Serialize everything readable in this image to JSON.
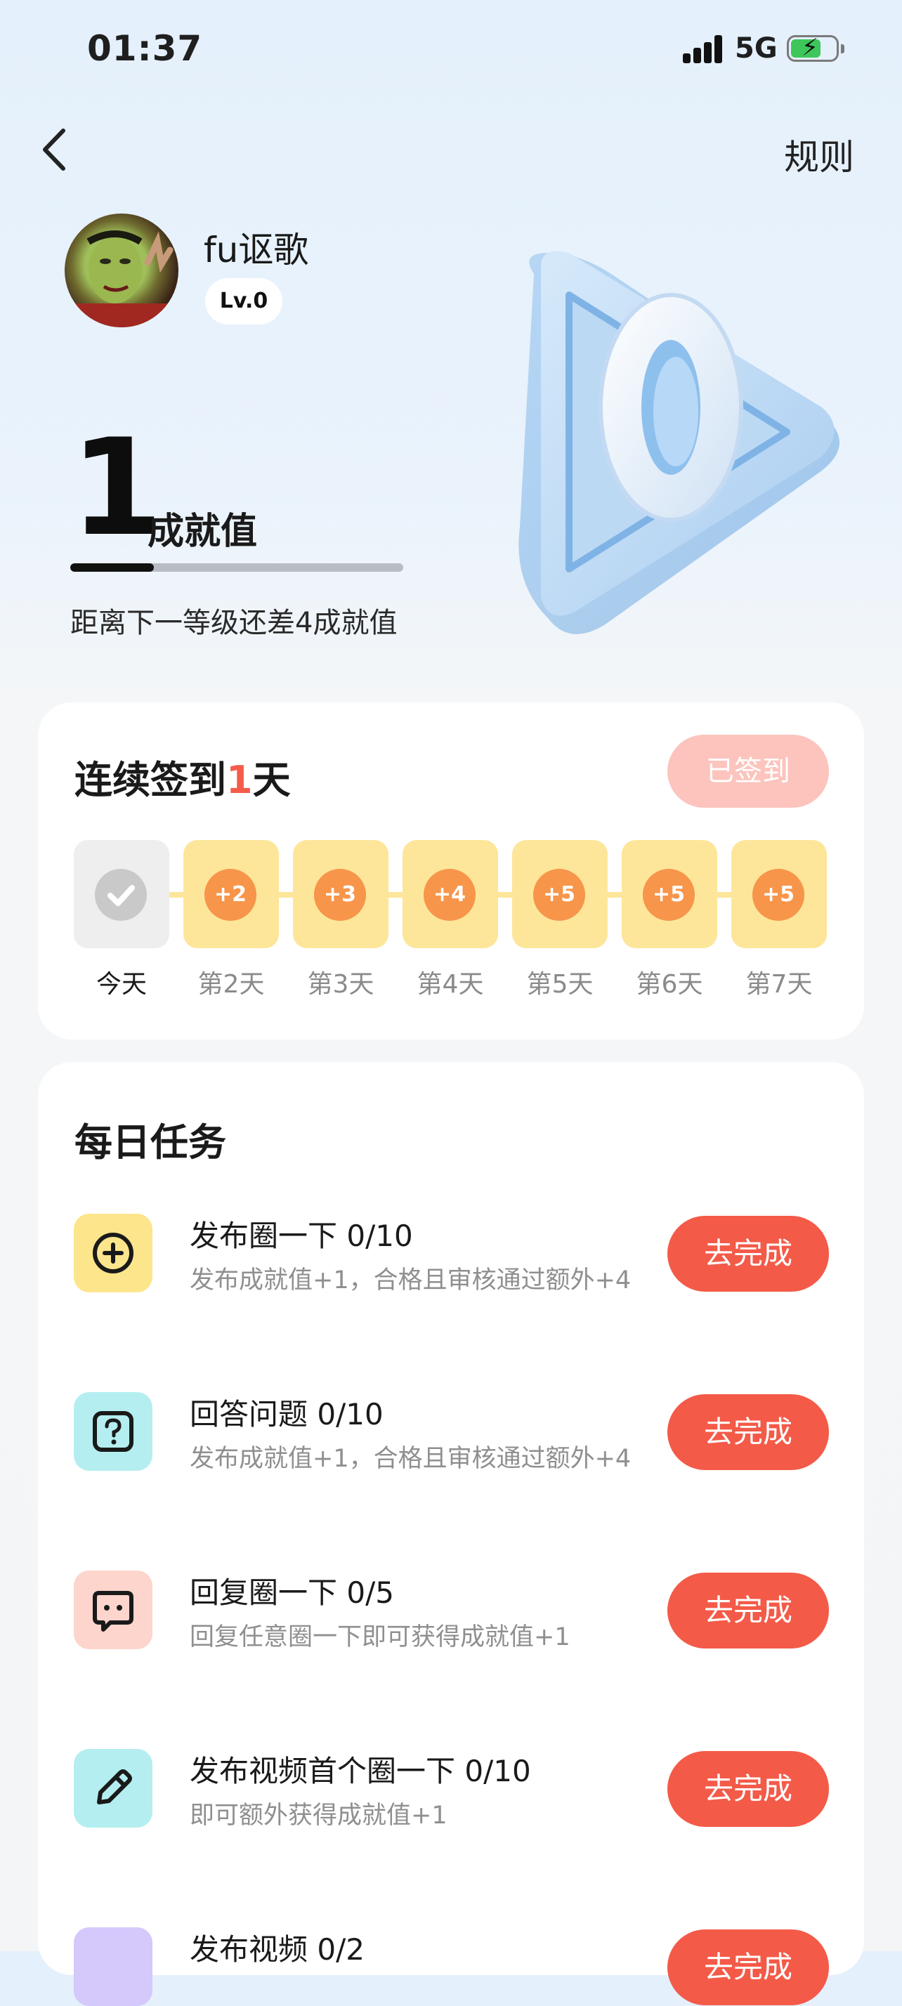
{
  "status_bar": {
    "time": "01:37",
    "network": "5G"
  },
  "nav": {
    "rules_label": "规则"
  },
  "profile": {
    "username": "fu讴歌",
    "level": "Lv.0",
    "score": "1",
    "score_unit": "成就值",
    "progress_fraction": 0.25,
    "progress_text": "距离下一等级还差4成就值",
    "badge_digit": "0"
  },
  "checkin": {
    "title_prefix": "连续签到",
    "days_count": "1",
    "title_suffix": "天",
    "button_label": "已签到",
    "days": [
      {
        "label": "今天",
        "reward": "",
        "done": true
      },
      {
        "label": "第2天",
        "reward": "+2",
        "done": false
      },
      {
        "label": "第3天",
        "reward": "+3",
        "done": false
      },
      {
        "label": "第4天",
        "reward": "+4",
        "done": false
      },
      {
        "label": "第5天",
        "reward": "+5",
        "done": false
      },
      {
        "label": "第6天",
        "reward": "+5",
        "done": false
      },
      {
        "label": "第7天",
        "reward": "+5",
        "done": false
      }
    ]
  },
  "tasks": {
    "title": "每日任务",
    "items": [
      {
        "name": "发布圈一下 0/10",
        "desc": "发布成就值+1，合格且审核通过额外+4",
        "button": "去完成",
        "icon": "plus-circle-icon",
        "icon_bg": "#fde58c"
      },
      {
        "name": "回答问题 0/10",
        "desc": "发布成就值+1，合格且审核通过额外+4",
        "button": "去完成",
        "icon": "question-icon",
        "icon_bg": "#b4eef0"
      },
      {
        "name": "回复圈一下 0/5",
        "desc": "回复任意圈一下即可获得成就值+1",
        "button": "去完成",
        "icon": "chat-bubble-icon",
        "icon_bg": "#fdd5cc"
      },
      {
        "name": "发布视频首个圈一下 0/10",
        "desc": "即可额外获得成就值+1",
        "button": "去完成",
        "icon": "pencil-icon",
        "icon_bg": "#b4eef0"
      },
      {
        "name": "发布视频 0/2",
        "desc": "",
        "button": "去完成",
        "icon": "video-icon",
        "icon_bg": "#d5c8fb"
      }
    ]
  }
}
